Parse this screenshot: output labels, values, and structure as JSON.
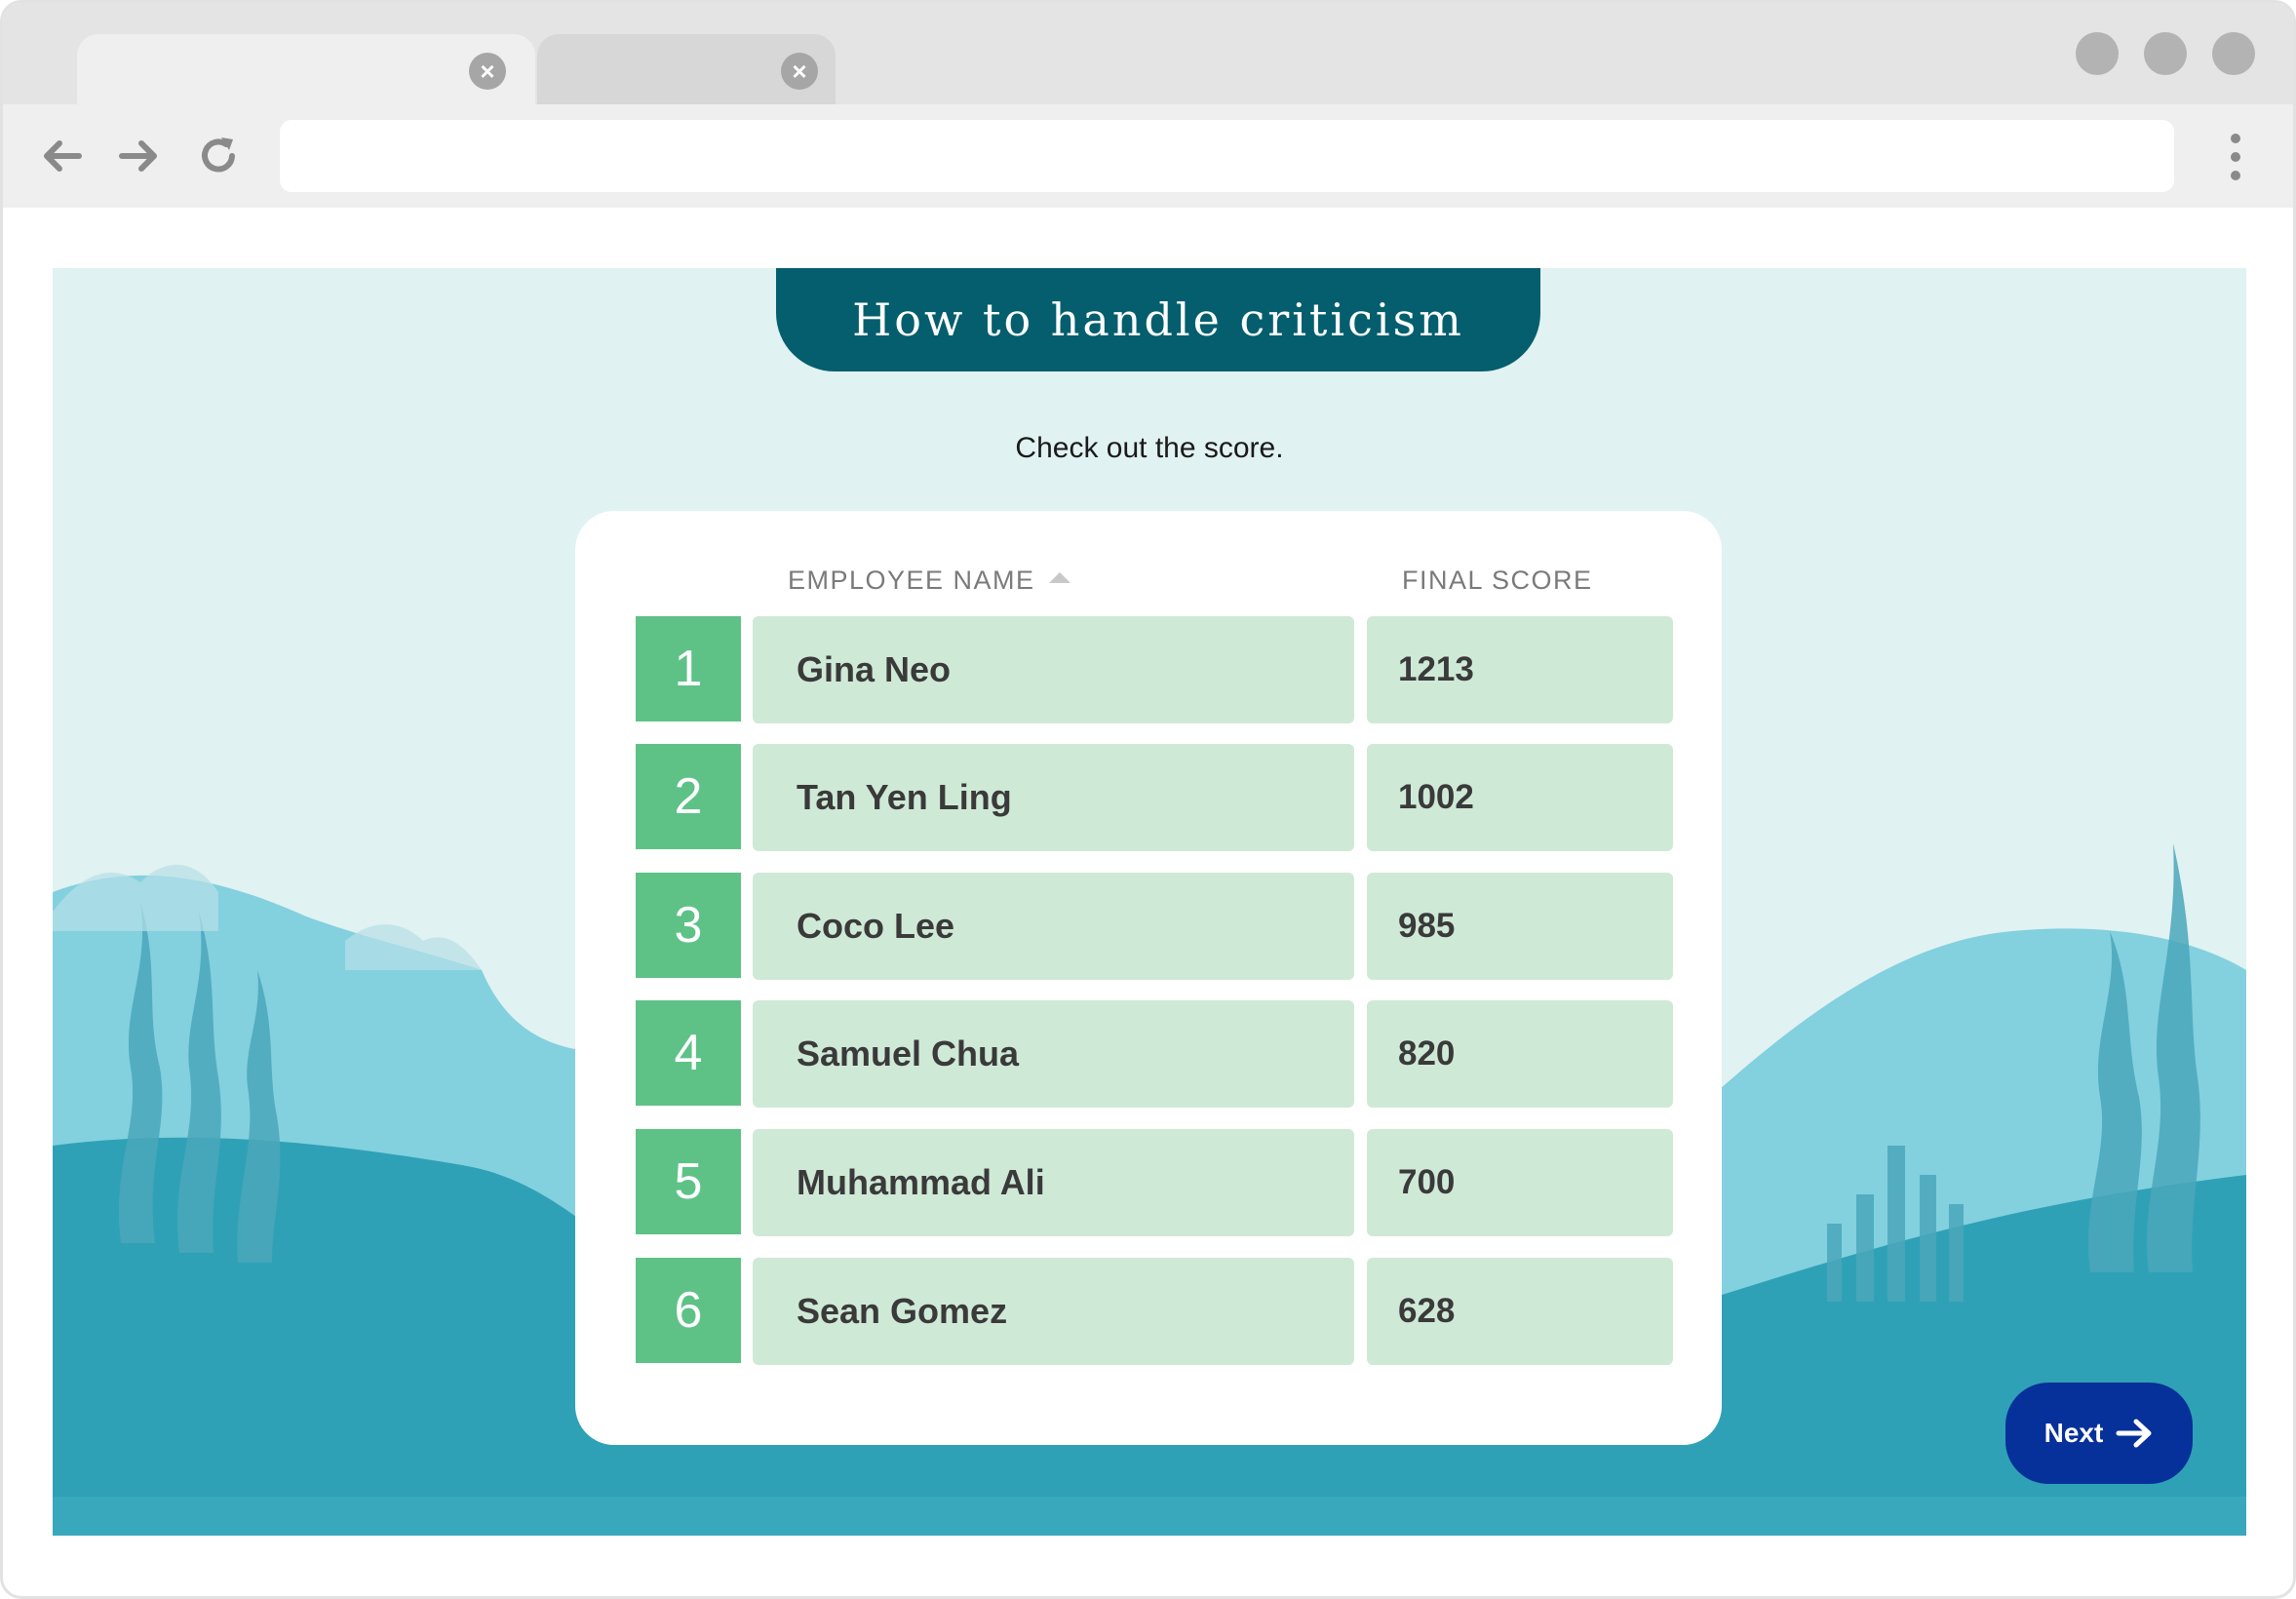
{
  "browser": {
    "tabs": [
      {
        "label": "",
        "active": true
      },
      {
        "label": "",
        "active": false
      }
    ],
    "address": "",
    "icons": {
      "back": "arrow-left-icon",
      "forward": "arrow-right-icon",
      "reload": "reload-icon",
      "menu": "kebab-menu-icon",
      "tab_close": "close-icon"
    }
  },
  "lesson": {
    "title": "How to handle criticism",
    "subtitle": "Check out the score."
  },
  "leaderboard": {
    "columns": {
      "name": "EMPLOYEE NAME",
      "score": "FINAL SCORE"
    },
    "sort": "name-ascending",
    "rows": [
      {
        "rank": "1",
        "name": "Gina Neo",
        "score": "1213"
      },
      {
        "rank": "2",
        "name": "Tan Yen Ling",
        "score": "1002"
      },
      {
        "rank": "3",
        "name": "Coco Lee",
        "score": "985"
      },
      {
        "rank": "4",
        "name": "Samuel Chua",
        "score": "820"
      },
      {
        "rank": "5",
        "name": "Muhammad Ali",
        "score": "700"
      },
      {
        "rank": "6",
        "name": "Sean Gomez",
        "score": "628"
      }
    ]
  },
  "next_button": {
    "label": "Next",
    "icon": "arrow-right-icon"
  },
  "colors": {
    "banner": "#055e6e",
    "rank_green": "#5ec287",
    "cell_green": "#cfe9d7",
    "next_blue": "#06309a",
    "sea_light": "#83d0df",
    "sea_dark": "#2fa1b6",
    "sky": "#e0f2f1"
  }
}
